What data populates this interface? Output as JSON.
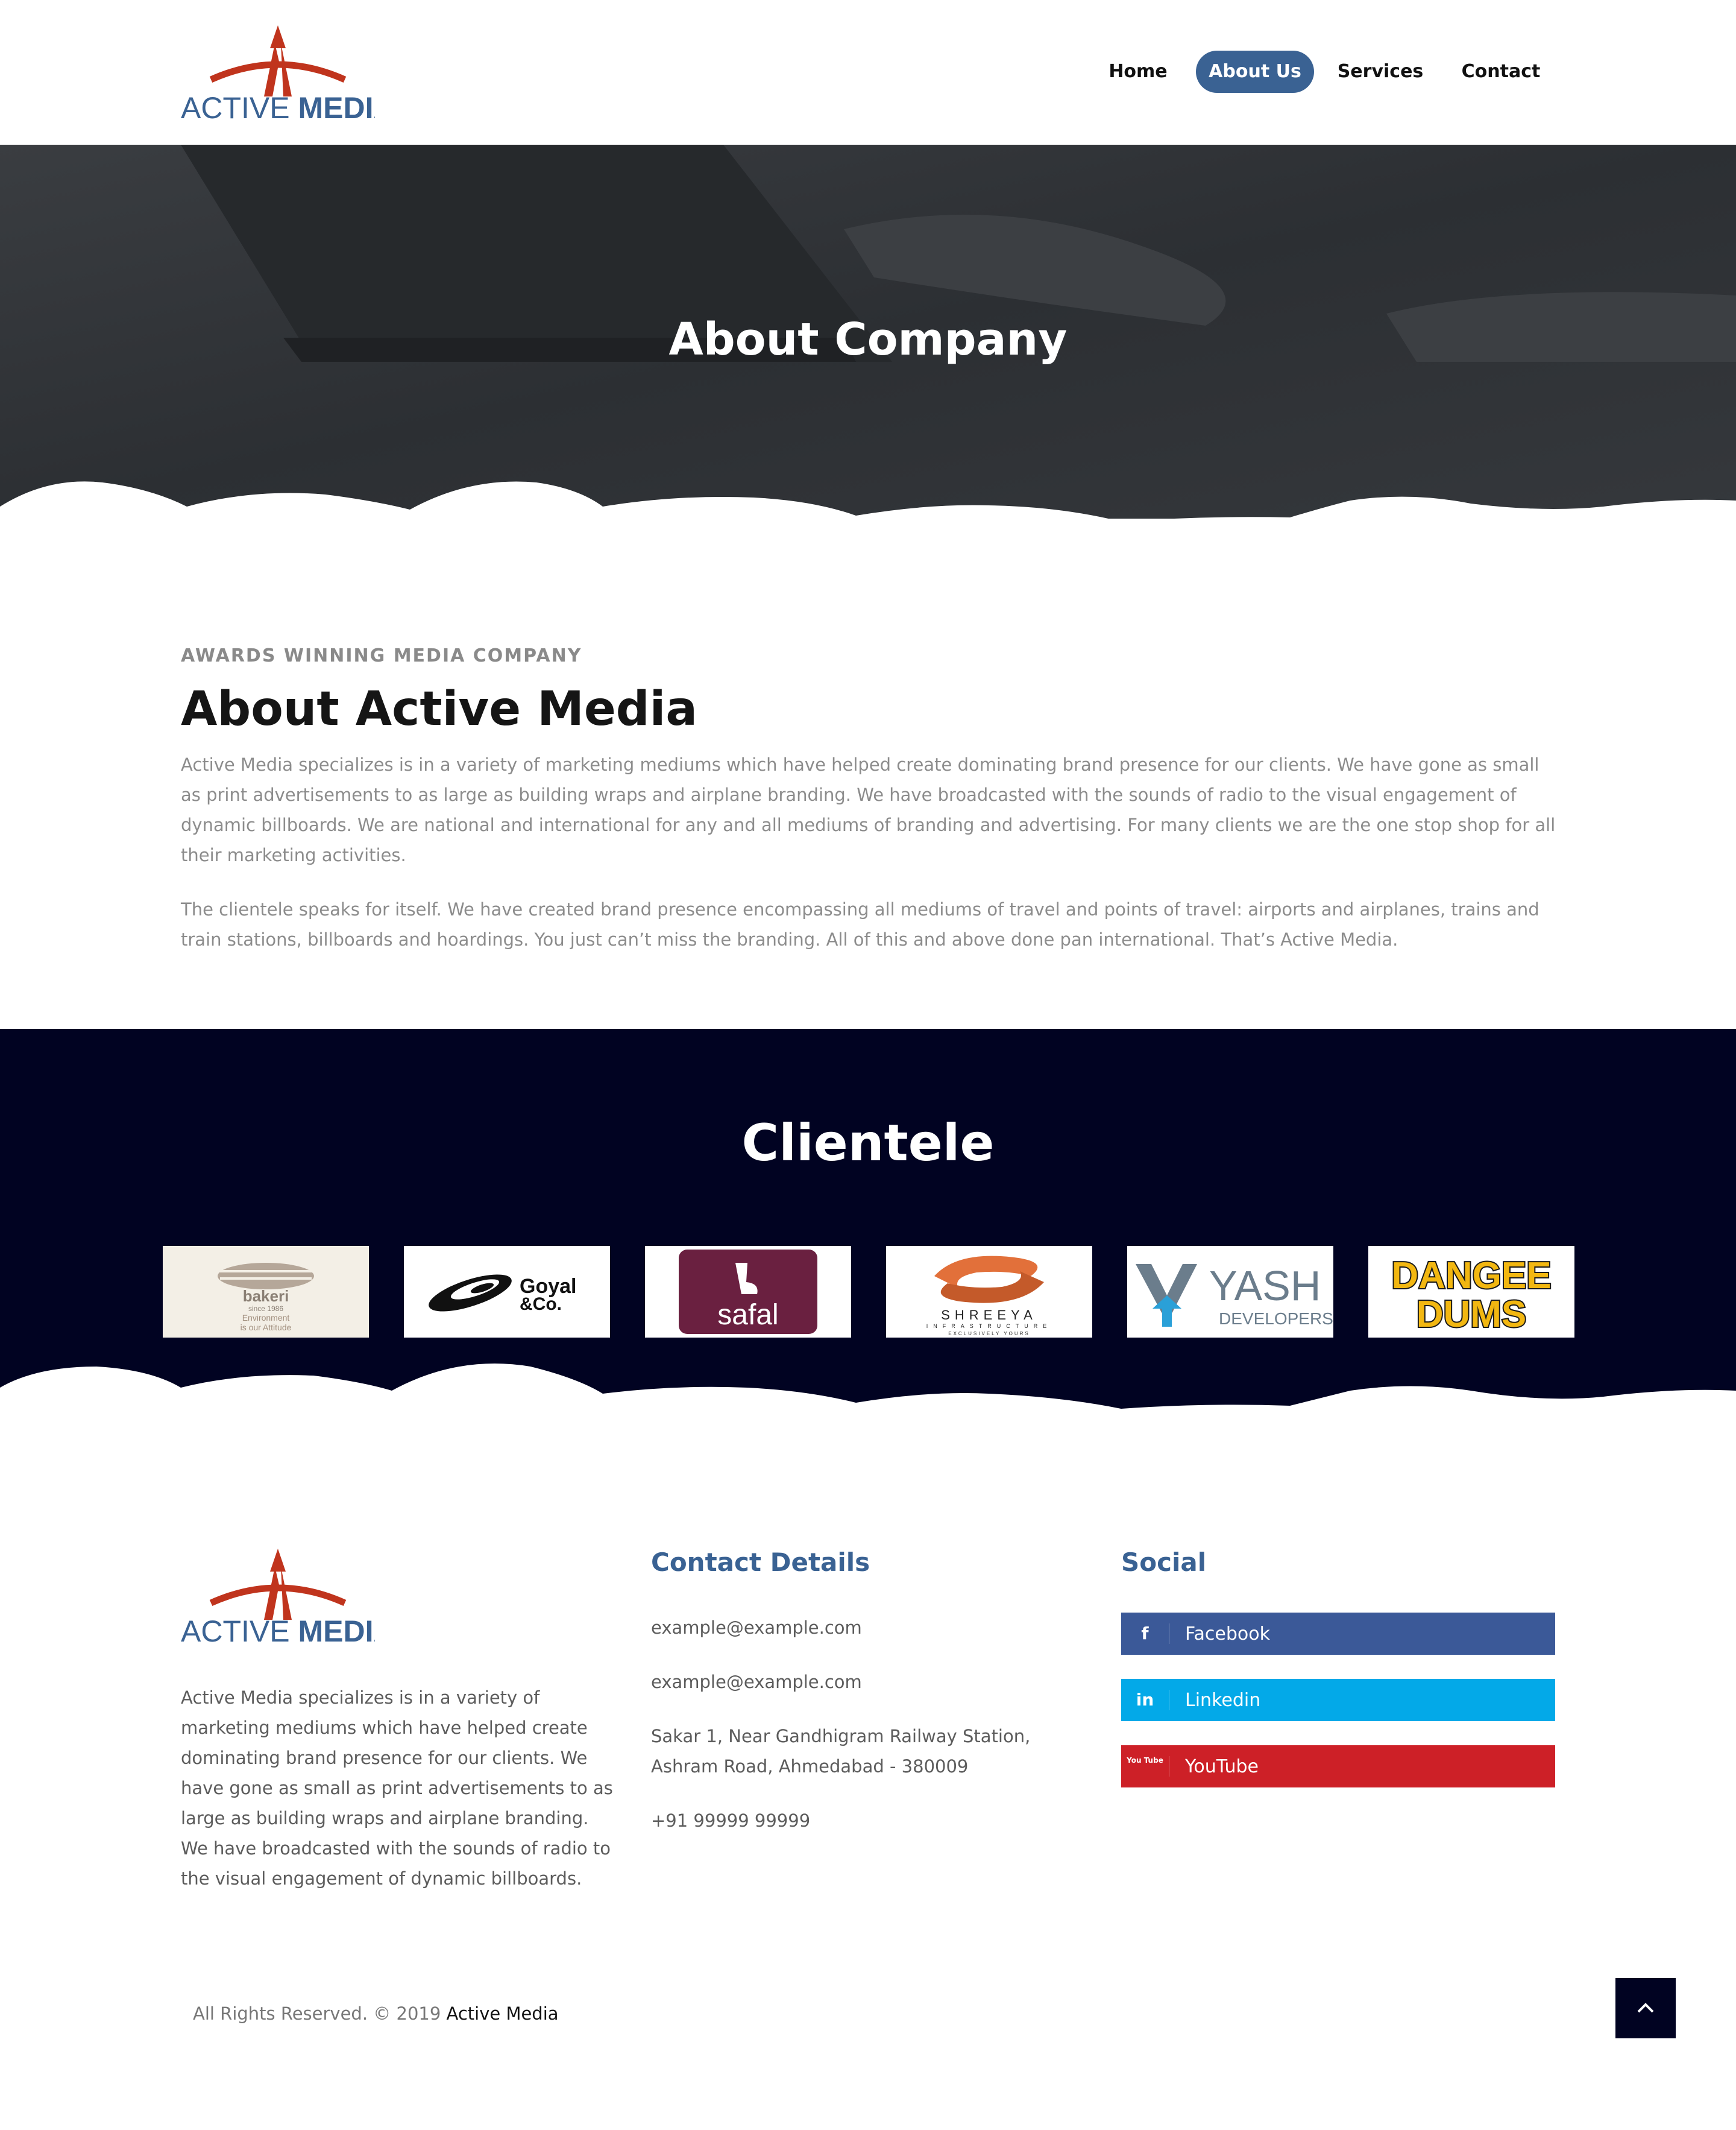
{
  "brand": {
    "name_part1": "ACTIVE",
    "name_part2": "MEDIA",
    "logo_red": "#c0341d",
    "logo_blue": "#3a6293"
  },
  "nav": {
    "items": [
      {
        "label": "Home",
        "active": false
      },
      {
        "label": "About Us",
        "active": true
      },
      {
        "label": "Services",
        "active": false
      },
      {
        "label": "Contact",
        "active": false
      }
    ],
    "active_color": "#3a6293"
  },
  "hero": {
    "title": "About Company"
  },
  "about": {
    "eyebrow": "AWARDS WINNING MEDIA COMPANY",
    "title": "About Active Media",
    "paragraph1": "Active Media specializes is in a variety of marketing mediums which have helped create dominating brand presence for our clients. We have gone as small as print advertisements to as large as building wraps and airplane branding. We have broadcasted with the sounds of radio to the visual engagement of dynamic billboards. We are national and international for any and all mediums of branding and advertising. For many clients we are the one stop shop for all their marketing activities.",
    "paragraph2": "The clientele speaks for itself. We have created brand presence encompassing all mediums of travel and points of travel: airports and airplanes, trains and train stations, billboards and hoardings. You just can’t miss the branding. All of this and above done pan international. That’s Active Media."
  },
  "clientele": {
    "title": "Clientele",
    "background": "#010322",
    "logos": [
      {
        "name": "bakeri",
        "line1": "bakeri",
        "line2": "since 1986",
        "line3": "Environment",
        "line4": "is our Attitude"
      },
      {
        "name": "goyal",
        "line1": "Goyal",
        "line2": "&Co."
      },
      {
        "name": "safal",
        "line1": "safal"
      },
      {
        "name": "shreeya",
        "line1": "SHREEYA",
        "line2": "INFRASTRUCTURE",
        "line3": "EXCLUSIVELY YOURS"
      },
      {
        "name": "yash",
        "line1": "YASH",
        "line2": "DEVELOPERS"
      },
      {
        "name": "dangee-dums",
        "line1": "DANGEE",
        "line2": "DUMS"
      }
    ]
  },
  "footer": {
    "about_text": "Active Media specializes is in a variety of marketing mediums which have helped create dominating brand presence for our clients. We have gone as small as print advertisements to as large as building wraps and airplane branding. We have broadcasted with the sounds of radio to the visual engagement of dynamic billboards.",
    "contact": {
      "title": "Contact Details",
      "email1": "example@example.com",
      "email2": "example@example.com",
      "address": "Sakar 1, Near Gandhigram Railway Station, Ashram Road, Ahmedabad - 380009",
      "phone": "+91 99999 99999"
    },
    "social": {
      "title": "Social",
      "items": [
        {
          "label": "Facebook",
          "icon": "facebook-icon",
          "glyph": "f",
          "color": "#3b5998"
        },
        {
          "label": "Linkedin",
          "icon": "linkedin-icon",
          "glyph": "in",
          "color": "#03a9e8"
        },
        {
          "label": "YouTube",
          "icon": "youtube-icon",
          "glyph": "You Tube",
          "color": "#cd2027"
        }
      ]
    },
    "copyright_prefix": "All Rights Reserved. © 2019",
    "copyright_brand": "Active Media"
  },
  "back_to_top": {
    "icon": "chevron-up-icon"
  }
}
